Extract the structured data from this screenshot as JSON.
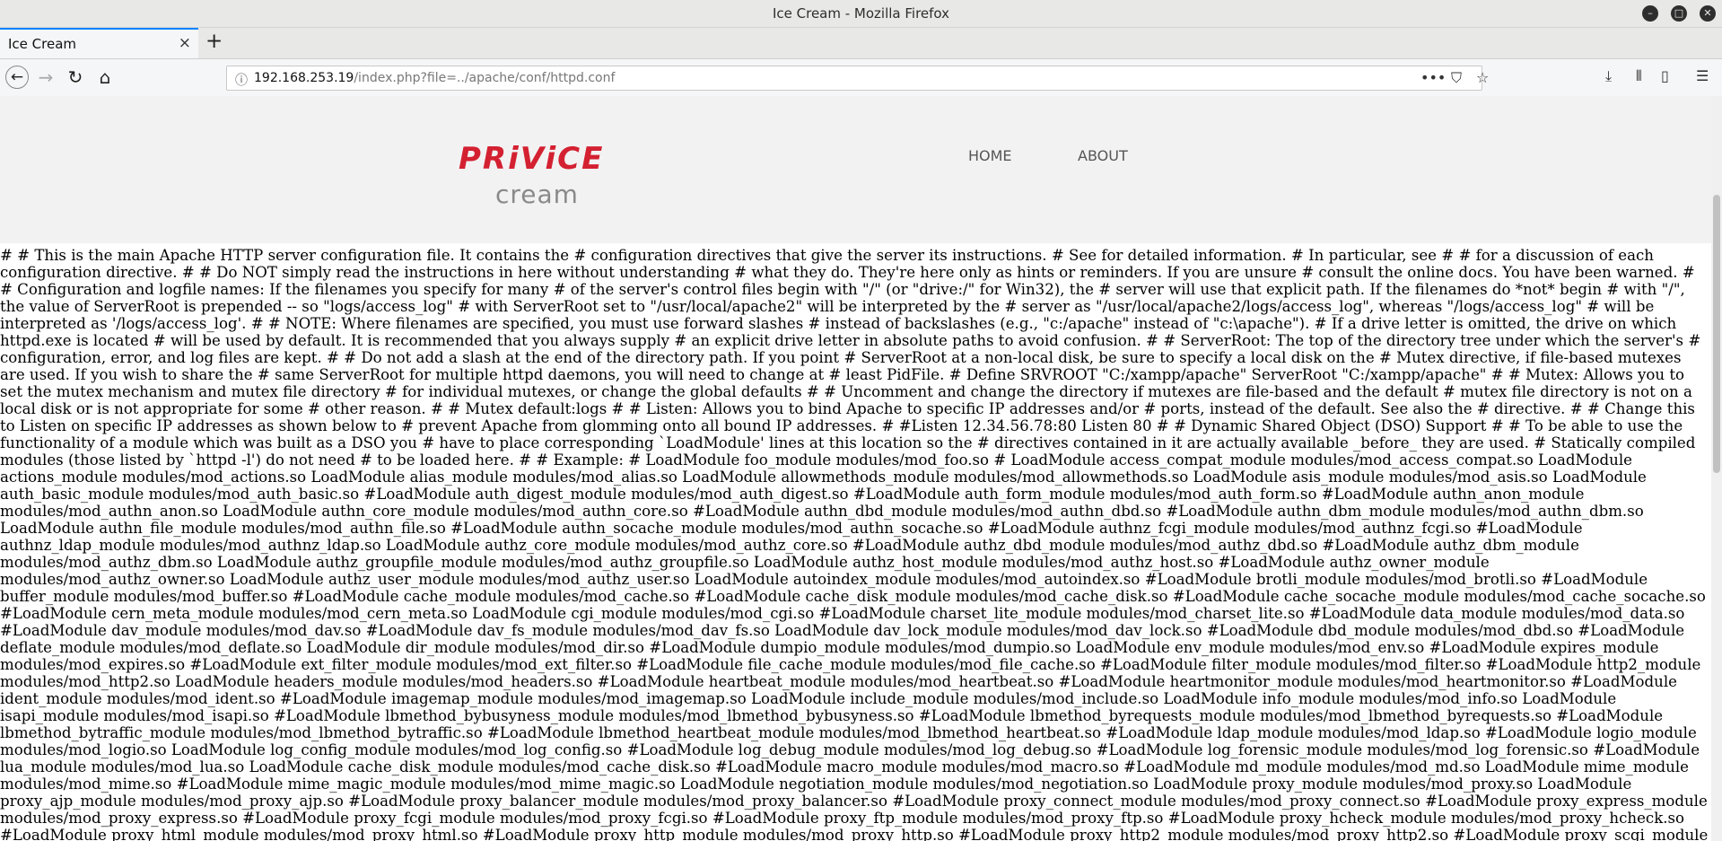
{
  "window": {
    "title": "Ice Cream - Mozilla Firefox",
    "controls": [
      "minimize-icon",
      "maximize-icon",
      "close-icon"
    ]
  },
  "tabs": [
    {
      "label": "Ice Cream",
      "active": true
    }
  ],
  "navbar": {
    "url_host": "192.168.253.19",
    "url_path": "/index.php?file=../apache/conf/httpd.conf",
    "icons": [
      "back-icon",
      "forward-icon",
      "reload-icon",
      "home-icon",
      "info-icon",
      "more-icon",
      "pocket-icon",
      "bookmark-star-icon",
      "download-icon",
      "library-icon",
      "sidebar-icon",
      "menu-icon"
    ]
  },
  "site": {
    "logo_top": "PRiViCE",
    "logo_bottom": "cream",
    "nav": [
      "HOME",
      "ABOUT"
    ],
    "brand_color": "#d42131"
  },
  "page_text": "# # This is the main Apache HTTP server configuration file. It contains the # configuration directives that give the server its instructions. # See for detailed information. # In particular, see # # for a discussion of each configuration directive. # # Do NOT simply read the instructions in here without understanding # what they do. They're here only as hints or reminders. If you are unsure # consult the online docs. You have been warned. # # Configuration and logfile names: If the filenames you specify for many # of the server's control files begin with \"/\" (or \"drive:/\" for Win32), the # server will use that explicit path. If the filenames do *not* begin # with \"/\", the value of ServerRoot is prepended -- so \"logs/access_log\" # with ServerRoot set to \"/usr/local/apache2\" will be interpreted by the # server as \"/usr/local/apache2/logs/access_log\", whereas \"/logs/access_log\" # will be interpreted as '/logs/access_log'. # # NOTE: Where filenames are specified, you must use forward slashes # instead of backslashes (e.g., \"c:/apache\" instead of \"c:\\apache\"). # If a drive letter is omitted, the drive on which httpd.exe is located # will be used by default. It is recommended that you always supply # an explicit drive letter in absolute paths to avoid confusion. # # ServerRoot: The top of the directory tree under which the server's # configuration, error, and log files are kept. # # Do not add a slash at the end of the directory path. If you point # ServerRoot at a non-local disk, be sure to specify a local disk on the # Mutex directive, if file-based mutexes are used. If you wish to share the # same ServerRoot for multiple httpd daemons, you will need to change at # least PidFile. # Define SRVROOT \"C:/xampp/apache\" ServerRoot \"C:/xampp/apache\" # # Mutex: Allows you to set the mutex mechanism and mutex file directory # for individual mutexes, or change the global defaults # # Uncomment and change the directory if mutexes are file-based and the default # mutex file directory is not on a local disk or is not appropriate for some # other reason. # # Mutex default:logs # # Listen: Allows you to bind Apache to specific IP addresses and/or # ports, instead of the default. See also the # directive. # # Change this to Listen on specific IP addresses as shown below to # prevent Apache from glomming onto all bound IP addresses. # #Listen 12.34.56.78:80 Listen 80 # # Dynamic Shared Object (DSO) Support # # To be able to use the functionality of a module which was built as a DSO you # have to place corresponding `LoadModule' lines at this location so the # directives contained in it are actually available _before_ they are used. # Statically compiled modules (those listed by `httpd -l') do not need # to be loaded here. # # Example: # LoadModule foo_module modules/mod_foo.so # LoadModule access_compat_module modules/mod_access_compat.so LoadModule actions_module modules/mod_actions.so LoadModule alias_module modules/mod_alias.so LoadModule allowmethods_module modules/mod_allowmethods.so LoadModule asis_module modules/mod_asis.so LoadModule auth_basic_module modules/mod_auth_basic.so #LoadModule auth_digest_module modules/mod_auth_digest.so #LoadModule auth_form_module modules/mod_auth_form.so #LoadModule authn_anon_module modules/mod_authn_anon.so LoadModule authn_core_module modules/mod_authn_core.so #LoadModule authn_dbd_module modules/mod_authn_dbd.so #LoadModule authn_dbm_module modules/mod_authn_dbm.so LoadModule authn_file_module modules/mod_authn_file.so #LoadModule authn_socache_module modules/mod_authn_socache.so #LoadModule authnz_fcgi_module modules/mod_authnz_fcgi.so #LoadModule authnz_ldap_module modules/mod_authnz_ldap.so LoadModule authz_core_module modules/mod_authz_core.so #LoadModule authz_dbd_module modules/mod_authz_dbd.so #LoadModule authz_dbm_module modules/mod_authz_dbm.so LoadModule authz_groupfile_module modules/mod_authz_groupfile.so LoadModule authz_host_module modules/mod_authz_host.so #LoadModule authz_owner_module modules/mod_authz_owner.so LoadModule authz_user_module modules/mod_authz_user.so LoadModule autoindex_module modules/mod_autoindex.so #LoadModule brotli_module modules/mod_brotli.so #LoadModule buffer_module modules/mod_buffer.so #LoadModule cache_module modules/mod_cache.so #LoadModule cache_disk_module modules/mod_cache_disk.so #LoadModule cache_socache_module modules/mod_cache_socache.so #LoadModule cern_meta_module modules/mod_cern_meta.so LoadModule cgi_module modules/mod_cgi.so #LoadModule charset_lite_module modules/mod_charset_lite.so #LoadModule data_module modules/mod_data.so #LoadModule dav_module modules/mod_dav.so #LoadModule dav_fs_module modules/mod_dav_fs.so LoadModule dav_lock_module modules/mod_dav_lock.so #LoadModule dbd_module modules/mod_dbd.so #LoadModule deflate_module modules/mod_deflate.so LoadModule dir_module modules/mod_dir.so #LoadModule dumpio_module modules/mod_dumpio.so LoadModule env_module modules/mod_env.so #LoadModule expires_module modules/mod_expires.so #LoadModule ext_filter_module modules/mod_ext_filter.so #LoadModule file_cache_module modules/mod_file_cache.so #LoadModule filter_module modules/mod_filter.so #LoadModule http2_module modules/mod_http2.so LoadModule headers_module modules/mod_headers.so #LoadModule heartbeat_module modules/mod_heartbeat.so #LoadModule heartmonitor_module modules/mod_heartmonitor.so #LoadModule ident_module modules/mod_ident.so #LoadModule imagemap_module modules/mod_imagemap.so LoadModule include_module modules/mod_include.so LoadModule info_module modules/mod_info.so LoadModule isapi_module modules/mod_isapi.so #LoadModule lbmethod_bybusyness_module modules/mod_lbmethod_bybusyness.so #LoadModule lbmethod_byrequests_module modules/mod_lbmethod_byrequests.so #LoadModule lbmethod_bytraffic_module modules/mod_lbmethod_bytraffic.so #LoadModule lbmethod_heartbeat_module modules/mod_lbmethod_heartbeat.so #LoadModule ldap_module modules/mod_ldap.so #LoadModule logio_module modules/mod_logio.so LoadModule log_config_module modules/mod_log_config.so #LoadModule log_debug_module modules/mod_log_debug.so #LoadModule log_forensic_module modules/mod_log_forensic.so #LoadModule lua_module modules/mod_lua.so LoadModule cache_disk_module modules/mod_cache_disk.so #LoadModule macro_module modules/mod_macro.so #LoadModule md_module modules/mod_md.so LoadModule mime_module modules/mod_mime.so #LoadModule mime_magic_module modules/mod_mime_magic.so LoadModule negotiation_module modules/mod_negotiation.so LoadModule proxy_module modules/mod_proxy.so LoadModule proxy_ajp_module modules/mod_proxy_ajp.so #LoadModule proxy_balancer_module modules/mod_proxy_balancer.so #LoadModule proxy_connect_module modules/mod_proxy_connect.so #LoadModule proxy_express_module modules/mod_proxy_express.so #LoadModule proxy_fcgi_module modules/mod_proxy_fcgi.so #LoadModule proxy_ftp_module modules/mod_proxy_ftp.so #LoadModule proxy_hcheck_module modules/mod_proxy_hcheck.so #LoadModule proxy_html_module modules/mod_proxy_html.so #LoadModule proxy_http_module modules/mod_proxy_http.so #LoadModule proxy_http2_module modules/mod_proxy_http2.so #LoadModule proxy_scgi_module modules/mod_proxy_scgi.so #LoadModule proxy_uwsgi_module modules/mod_proxy_uwsgi.so #LoadModule proxy_wstunnel_module modules/mod_proxy_wstunnel.so #LoadModule ratelimit_module modules/mod_ratelimit.so #LoadModule reflector_module modules/mod_reflector.so #LoadModule"
}
